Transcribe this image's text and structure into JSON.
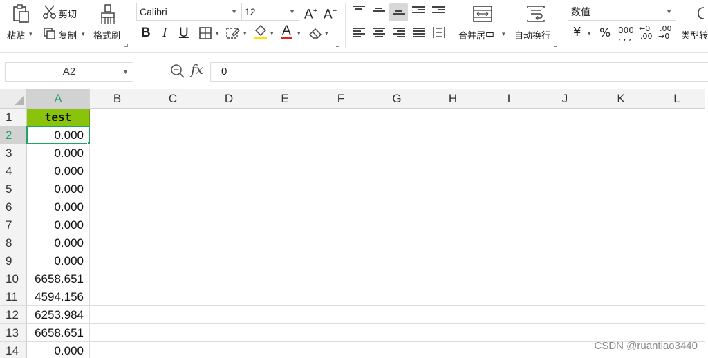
{
  "ribbon": {
    "clipboard": {
      "paste_label": "粘贴",
      "cut_label": "剪切",
      "copy_label": "复制",
      "format_painter_label": "格式刷"
    },
    "font": {
      "font_name": "Calibri",
      "font_size": "12",
      "bold": "B",
      "italic": "I",
      "underline": "U",
      "font_color_glyph": "A",
      "fill_color": "#ffe000",
      "font_color": "#e02020"
    },
    "alignment": {
      "merge_center_label": "合并居中",
      "wrap_text_label": "自动换行"
    },
    "number": {
      "format": "数值",
      "currency_glyph": "¥",
      "percent_glyph": "%",
      "thousands_glyph": "000",
      "increase_decimal_top": "←0",
      "increase_decimal_bottom": ".00",
      "decrease_decimal_top": ".00",
      "decrease_decimal_bottom": "→0",
      "type_convert_label": "类型转"
    }
  },
  "formula_bar": {
    "name_box": "A2",
    "fx_label": "fx",
    "value": "0"
  },
  "sheet": {
    "columns": [
      "A",
      "B",
      "C",
      "D",
      "E",
      "F",
      "G",
      "H",
      "I",
      "J",
      "K",
      "L"
    ],
    "selected_column": "A",
    "selected_row": 2,
    "header_fill": "#8ac30b",
    "selection_color": "#21a366",
    "rows": [
      {
        "num": "1",
        "a": "test"
      },
      {
        "num": "2",
        "a": "0.000"
      },
      {
        "num": "3",
        "a": "0.000"
      },
      {
        "num": "4",
        "a": "0.000"
      },
      {
        "num": "5",
        "a": "0.000"
      },
      {
        "num": "6",
        "a": "0.000"
      },
      {
        "num": "7",
        "a": "0.000"
      },
      {
        "num": "8",
        "a": "0.000"
      },
      {
        "num": "9",
        "a": "0.000"
      },
      {
        "num": "10",
        "a": "6658.651"
      },
      {
        "num": "11",
        "a": "4594.156"
      },
      {
        "num": "12",
        "a": "6253.984"
      },
      {
        "num": "13",
        "a": "6658.651"
      },
      {
        "num": "14",
        "a": "0.000"
      }
    ]
  },
  "watermark": "CSDN @ruantiao3440"
}
